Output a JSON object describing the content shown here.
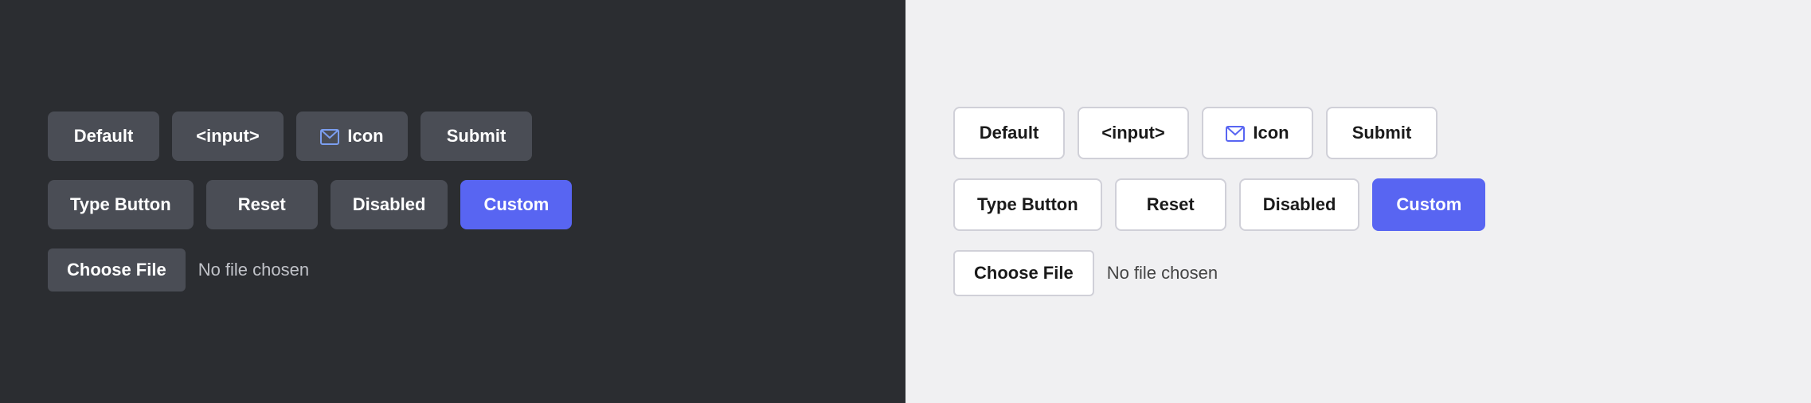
{
  "dark_panel": {
    "row1": {
      "btn1": {
        "label": "Default"
      },
      "btn2": {
        "label": "<input>"
      },
      "btn3": {
        "label": "Icon",
        "icon": "envelope"
      },
      "btn4": {
        "label": "Submit"
      }
    },
    "row2": {
      "btn1": {
        "label": "Type Button"
      },
      "btn2": {
        "label": "Reset"
      },
      "btn3": {
        "label": "Disabled"
      },
      "btn4": {
        "label": "Custom"
      }
    },
    "file": {
      "btn_label": "Choose File",
      "no_file": "No file chosen"
    }
  },
  "light_panel": {
    "row1": {
      "btn1": {
        "label": "Default"
      },
      "btn2": {
        "label": "<input>"
      },
      "btn3": {
        "label": "Icon",
        "icon": "envelope"
      },
      "btn4": {
        "label": "Submit"
      }
    },
    "row2": {
      "btn1": {
        "label": "Type Button"
      },
      "btn2": {
        "label": "Reset"
      },
      "btn3": {
        "label": "Disabled"
      },
      "btn4": {
        "label": "Custom"
      }
    },
    "file": {
      "btn_label": "Choose File",
      "no_file": "No file chosen"
    }
  }
}
